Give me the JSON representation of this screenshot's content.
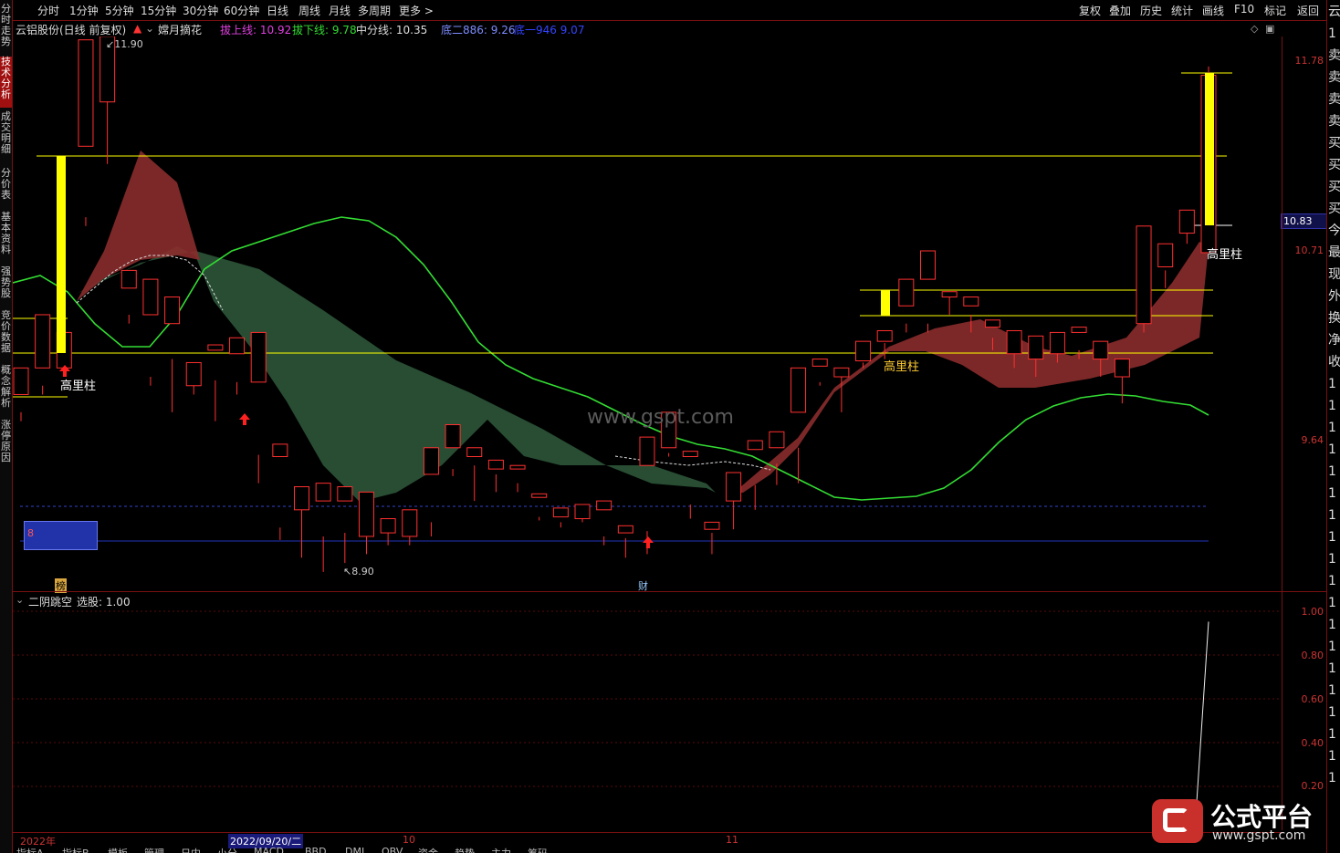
{
  "toolbar": {
    "periods": [
      "分时",
      "1分钟",
      "5分钟",
      "15分钟",
      "30分钟",
      "60分钟",
      "日线",
      "周线",
      "月线",
      "多周期",
      "更多 >"
    ],
    "right_items": [
      "复权",
      "叠加",
      "历史",
      "统计",
      "画线",
      "F10",
      "标记",
      "返回"
    ]
  },
  "left_tabs": [
    {
      "label": "分时走势",
      "active": false
    },
    {
      "label": "技术分析",
      "active": true
    },
    {
      "label": "成交明细",
      "active": false
    },
    {
      "label": "分价表",
      "active": false
    },
    {
      "label": "基本资料",
      "active": false
    },
    {
      "label": "强势股",
      "active": false
    },
    {
      "label": "竞价数据",
      "active": false
    },
    {
      "label": "概念解析",
      "active": false
    },
    {
      "label": "涨停原因",
      "active": false
    }
  ],
  "right_panel_chars": [
    "云",
    "1",
    "卖",
    "卖",
    "卖",
    "卖",
    "买",
    "买",
    "买",
    "买",
    "今",
    "最",
    "现",
    "外",
    "换",
    "净",
    "收",
    "1",
    "1",
    "1",
    "1",
    "1",
    "1",
    "1",
    "1",
    "1",
    "1",
    "1",
    "1",
    "1",
    "1",
    "1",
    "1",
    "1",
    "1",
    "1"
  ],
  "info": {
    "stock": "云铝股份(日线 前复权)",
    "indicator": "嫦月摘花",
    "upper_label": "拔上线: ",
    "upper_value": "10.92",
    "lower_label": "拔下线: ",
    "lower_value": "9.78",
    "mid_label": "中分线: ",
    "mid_value": "10.35",
    "bottom2_label": "底二886: ",
    "bottom2_value": "9.26",
    "bottom1_label": "底一946 ",
    "bottom1_value": "9.07"
  },
  "price_axis": {
    "labels": [
      {
        "text": "11.78",
        "price": 11.78
      },
      {
        "text": "10.71",
        "price": 10.71
      },
      {
        "text": "9.64",
        "price": 9.64
      }
    ],
    "current": "10.83",
    "ellipsis_rows": [
      "14",
      "14",
      "14",
      "14",
      "14",
      "14",
      "14",
      "14",
      "14",
      "14",
      "14"
    ]
  },
  "annotations": {
    "high_label": "11.90",
    "low_label": "8.90",
    "gaoli_left": "高里柱",
    "gaoli_mid": "高里柱",
    "gaoli_right": "高里柱",
    "watermark": "www.gspt.com",
    "bang": "榜",
    "cai": "财",
    "box_num": "8"
  },
  "sub_panel": {
    "title": "二阴跳空",
    "select_label": "选股: ",
    "select_value": "1.00",
    "axis": [
      "1.00",
      "0.80",
      "0.60",
      "0.40",
      "0.20"
    ]
  },
  "date_axis": [
    "2022年",
    "2022/09/20/二",
    "10",
    "11"
  ],
  "bottom_tabs": [
    "指标A",
    "指标B",
    "模板",
    "管理",
    "日内",
    "小分",
    "MACD",
    "BBD",
    "DMI",
    "OBV",
    "资金",
    "趋势",
    "主力",
    "筹码"
  ],
  "logo": {
    "text": "公式平台",
    "url": "www.gspt.com"
  },
  "colors": {
    "up": "#ff3030",
    "down": "#54ffff",
    "green_line": "#33dd33",
    "yellow": "#ffff00",
    "dark_red_band": "#8a2c2c",
    "dark_green_band": "#2f5a3c",
    "axis_red": "#c33333",
    "navy": "#2233aa"
  },
  "chart_data": {
    "type": "candlestick",
    "title": "云铝股份(日线 前复权)",
    "period": "日线",
    "y_labels": [
      11.78,
      10.71,
      9.64
    ],
    "visible_extremes": {
      "high": 11.9,
      "low": 8.9
    },
    "ohlc": [
      [
        9.9,
        10.05,
        9.8,
        9.75
      ],
      [
        10.05,
        10.35,
        9.95,
        9.9
      ],
      [
        10.05,
        10.25,
        10.05,
        10.0
      ],
      [
        11.3,
        11.9,
        10.9,
        10.85
      ],
      [
        11.55,
        11.92,
        11.55,
        11.2
      ],
      [
        10.5,
        10.6,
        10.35,
        10.3
      ],
      [
        10.35,
        10.55,
        10.0,
        9.95
      ],
      [
        10.3,
        10.45,
        10.1,
        9.8
      ],
      [
        9.95,
        10.08,
        9.95,
        9.9
      ],
      [
        10.15,
        10.18,
        9.98,
        9.75
      ],
      [
        10.13,
        10.22,
        9.97,
        9.9
      ],
      [
        9.97,
        10.25,
        9.56,
        9.4
      ],
      [
        9.55,
        9.62,
        9.15,
        9.08
      ],
      [
        9.25,
        9.38,
        9.25,
        8.98
      ],
      [
        9.3,
        9.4,
        9.1,
        8.9
      ],
      [
        9.3,
        9.38,
        9.12,
        8.95
      ],
      [
        9.1,
        9.35,
        9.1,
        9.0
      ],
      [
        9.12,
        9.2,
        9.15,
        9.05
      ],
      [
        9.1,
        9.25,
        9.15,
        9.05
      ],
      [
        9.45,
        9.6,
        9.18,
        9.1
      ],
      [
        9.6,
        9.73,
        9.48,
        9.44
      ],
      [
        9.55,
        9.6,
        9.5,
        9.3
      ],
      [
        9.48,
        9.53,
        9.45,
        9.35
      ],
      [
        9.48,
        9.5,
        9.4,
        9.35
      ],
      [
        9.32,
        9.34,
        9.21,
        9.19
      ],
      [
        9.21,
        9.26,
        9.18,
        9.15
      ],
      [
        9.2,
        9.28,
        9.25,
        9.18
      ],
      [
        9.25,
        9.3,
        9.1,
        9.05
      ],
      [
        9.12,
        9.16,
        9.09,
        8.98
      ],
      [
        9.5,
        9.66,
        9.13,
        9.0
      ],
      [
        9.6,
        9.8,
        9.57,
        9.55
      ],
      [
        9.55,
        9.58,
        9.28,
        9.2
      ],
      [
        9.14,
        9.18,
        9.12,
        9.0
      ],
      [
        9.3,
        9.46,
        9.38,
        9.14
      ],
      [
        9.59,
        9.64,
        9.39,
        9.25
      ],
      [
        9.6,
        9.69,
        9.51,
        9.39
      ],
      [
        9.8,
        10.05,
        9.6,
        9.4
      ],
      [
        10.06,
        10.1,
        9.97,
        9.95
      ],
      [
        10.0,
        10.05,
        10.0,
        9.8
      ],
      [
        10.09,
        10.2,
        10.08,
        10.05
      ],
      [
        10.2,
        10.26,
        10.19,
        10.1
      ],
      [
        10.4,
        10.55,
        10.3,
        10.25
      ],
      [
        10.55,
        10.71,
        10.3,
        10.25
      ],
      [
        10.45,
        10.48,
        10.45,
        10.35
      ],
      [
        10.4,
        10.45,
        10.35,
        10.25
      ],
      [
        10.28,
        10.32,
        10.22,
        10.15
      ],
      [
        10.13,
        10.26,
        10.16,
        10.05
      ],
      [
        10.1,
        10.23,
        10.1,
        10.0
      ],
      [
        10.13,
        10.25,
        10.13,
        10.08
      ],
      [
        10.25,
        10.28,
        10.15,
        10.1
      ],
      [
        10.1,
        10.2,
        10.15,
        10.0
      ],
      [
        10.0,
        10.1,
        10.0,
        9.85
      ],
      [
        10.3,
        10.85,
        10.65,
        10.25
      ],
      [
        10.62,
        10.75,
        10.6,
        10.5
      ],
      [
        10.81,
        10.94,
        10.81,
        10.75
      ],
      [
        10.7,
        11.7,
        11.75,
        10.7
      ]
    ],
    "sub_indicator": {
      "name": "二阴跳空",
      "values": [
        0,
        0,
        0,
        0,
        1.0
      ],
      "ylim": [
        0,
        1.05
      ]
    }
  }
}
